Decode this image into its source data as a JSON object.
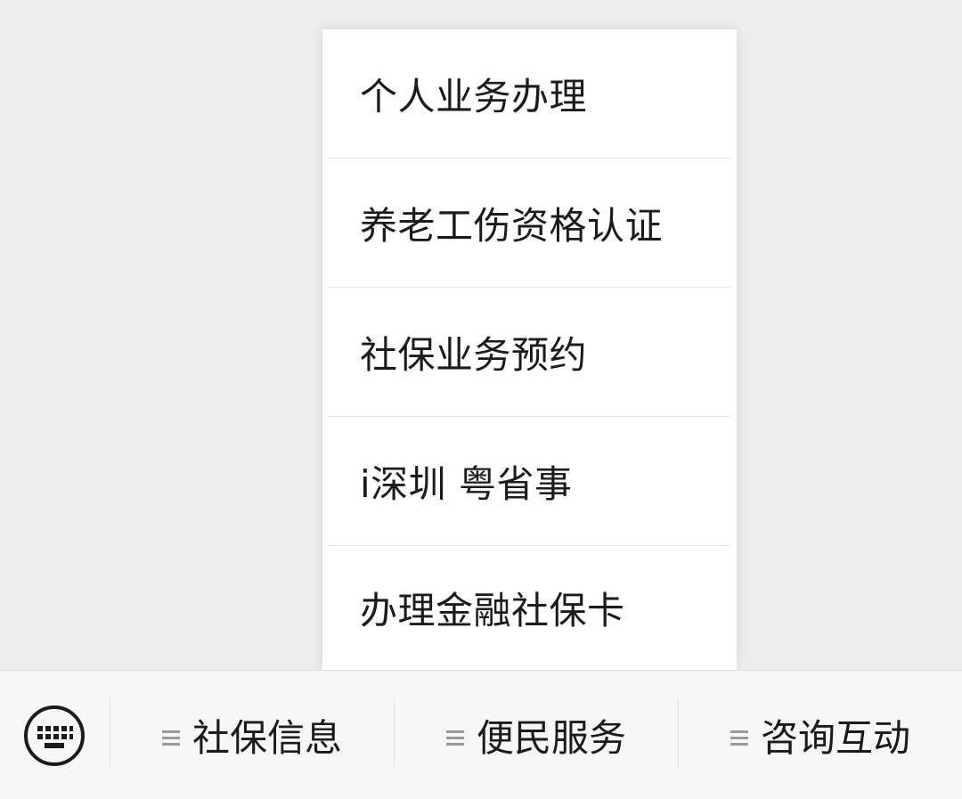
{
  "submenu": {
    "items": [
      {
        "label": "个人业务办理"
      },
      {
        "label": "养老工伤资格认证"
      },
      {
        "label": "社保业务预约"
      },
      {
        "label": "i深圳 粤省事"
      },
      {
        "label": "办理金融社保卡"
      }
    ]
  },
  "menubar": {
    "keyboard_icon": "keyboard-icon",
    "tabs": [
      {
        "label": "社保信息",
        "icon": "menu-lines-icon"
      },
      {
        "label": "便民服务",
        "icon": "menu-lines-icon"
      },
      {
        "label": "咨询互动",
        "icon": "menu-lines-icon"
      }
    ]
  },
  "colors": {
    "background": "#ededed",
    "popup": "#ffffff",
    "menubar": "#f7f7f7",
    "text": "#1b1b1b",
    "icon_gray": "#9a9a9a"
  }
}
